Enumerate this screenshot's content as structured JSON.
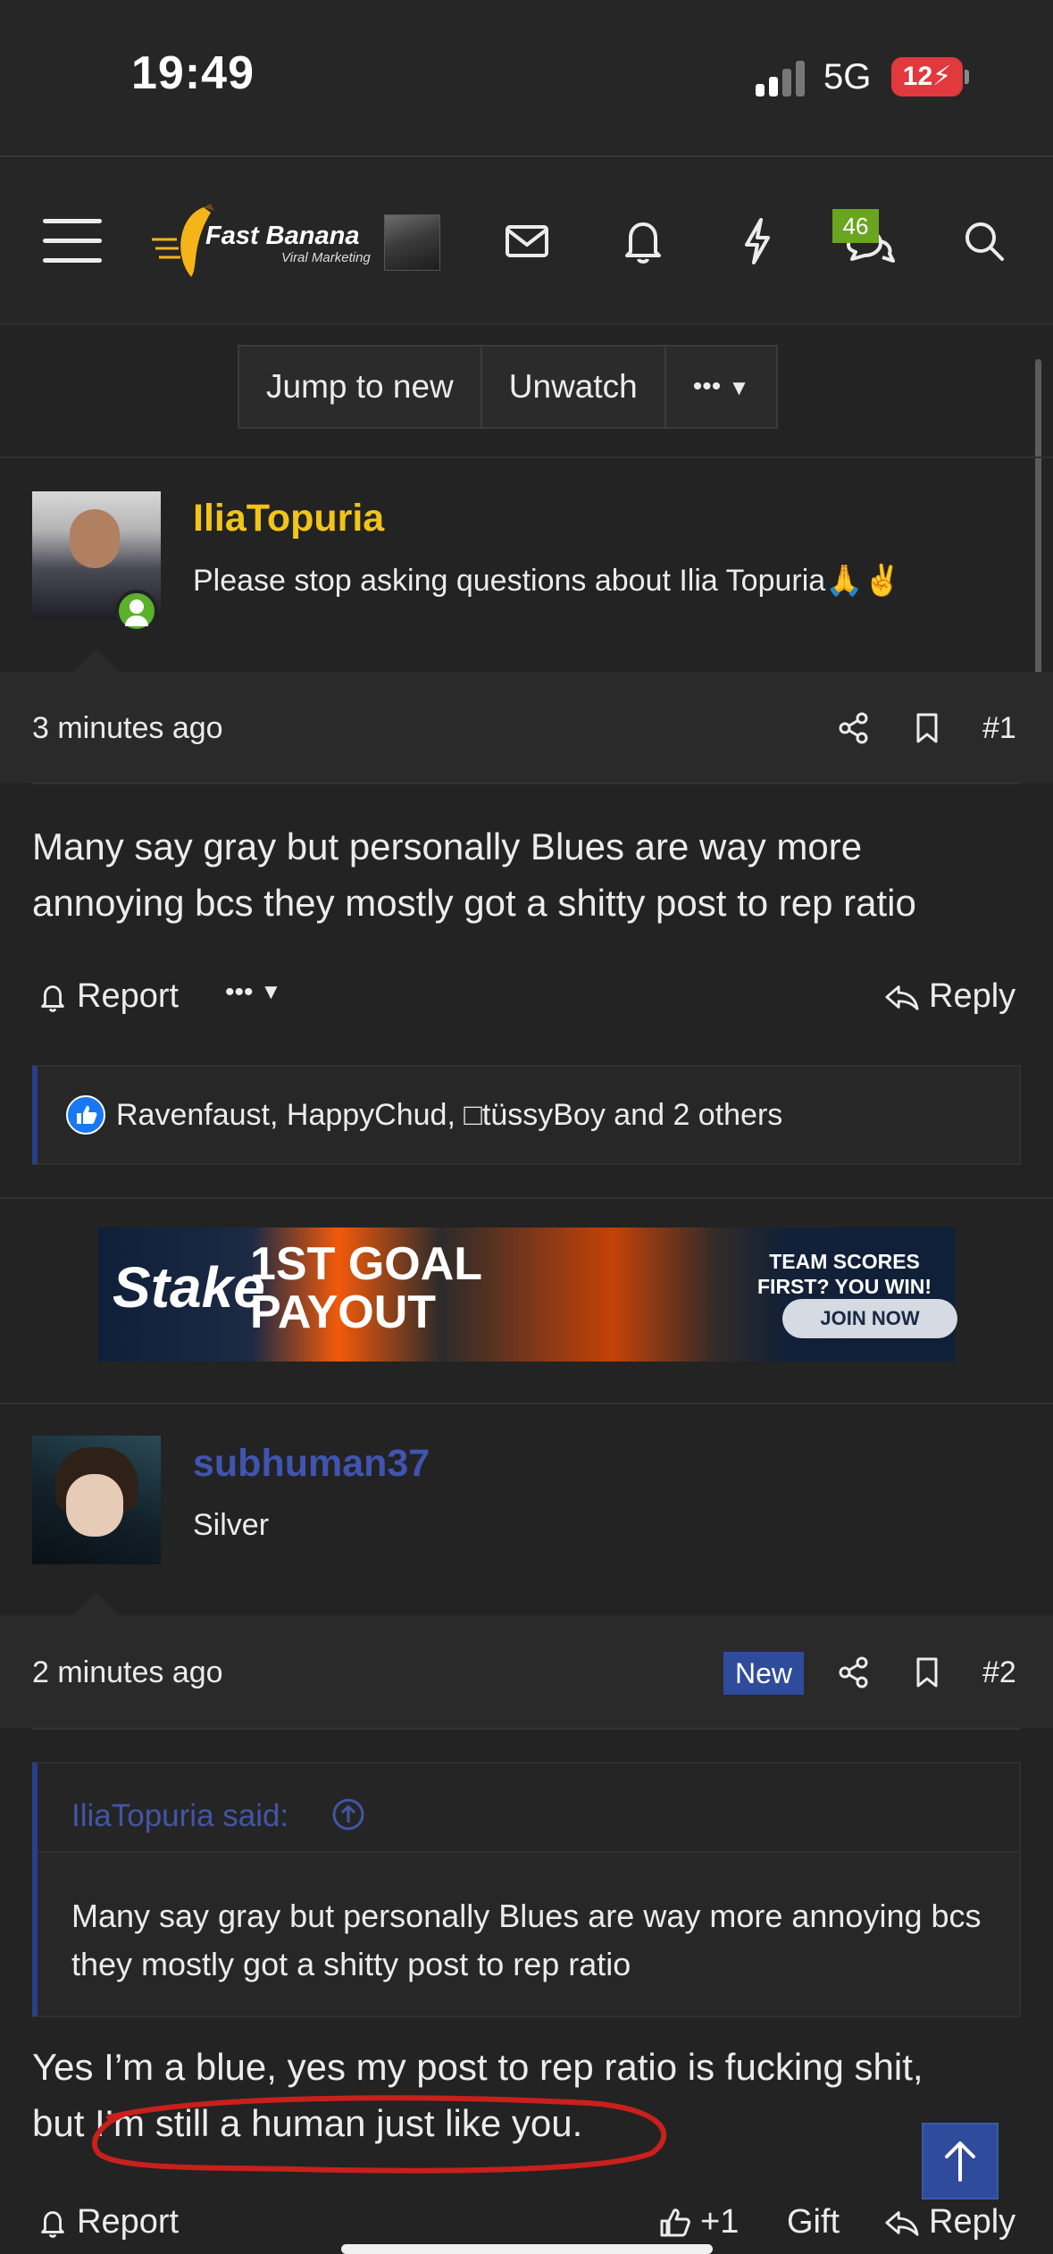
{
  "status_bar": {
    "time": "19:49",
    "network": "5G",
    "battery": "12"
  },
  "nav": {
    "brand": "Fast Banana",
    "brand_sub": "Viral Marketing",
    "conversations_badge": "46"
  },
  "thread_actions": {
    "jump_to_new": "Jump to new",
    "unwatch": "Unwatch",
    "more": "•••"
  },
  "posts": [
    {
      "username": "IliaTopuria",
      "user_title": "Please stop asking questions about Ilia Topuria🙏✌️",
      "time": "3 minutes ago",
      "number": "#1",
      "body": "Many say gray but personally Blues are way more annoying bcs they mostly got a shitty post to rep ratio",
      "report_label": "Report",
      "more_label": "•••",
      "reply_label": "Reply",
      "reactions": "Ravenfaust, HappyChud, □tüssyBoy and 2 others"
    },
    {
      "username": "subhuman37",
      "user_title": "Silver",
      "time": "2 minutes ago",
      "new_badge": "New",
      "number": "#2",
      "quote_attribution": "IliaTopuria said:",
      "quote_body": "Many say gray but personally Blues are way more annoying bcs they mostly got a shitty post to rep ratio",
      "body_line1": "Yes I’m a blue, yes my post to rep ratio is fucking shit,",
      "body_line2": "but I’m still a human just like you.",
      "report_label": "Report",
      "like_label": "+1",
      "gift_label": "Gift",
      "reply_label": "Reply"
    }
  ],
  "ad": {
    "brand": "Stake",
    "headline_1": "1ST GOAL",
    "headline_2": "PAYOUT",
    "tagline_1": "TEAM SCORES",
    "tagline_2": "FIRST? YOU WIN!",
    "cta": "JOIN NOW"
  },
  "colors": {
    "background": "#232323",
    "username_gold": "#f0c419",
    "username_blue": "#4054b0",
    "accent_blue": "#2f4b9b",
    "online_green": "#5bb02c",
    "annotation_red": "#c8201c"
  }
}
